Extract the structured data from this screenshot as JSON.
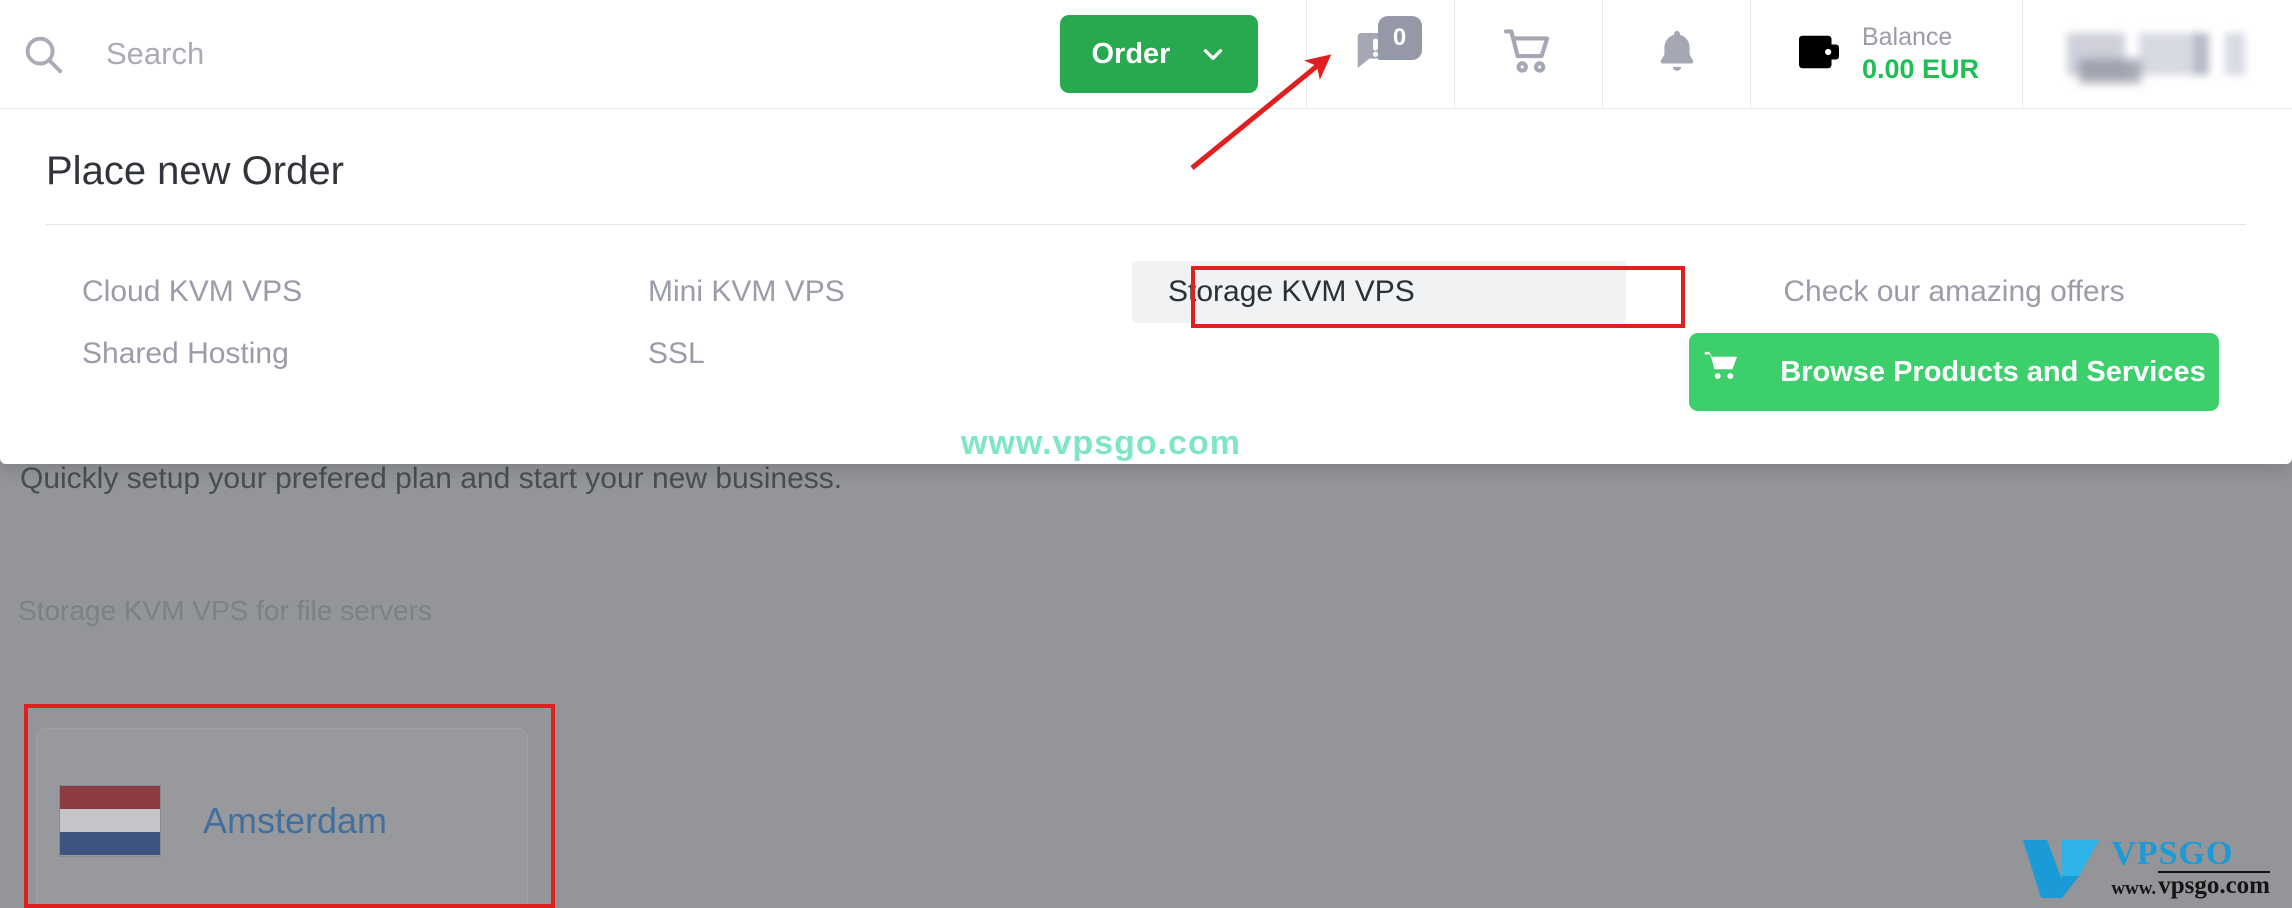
{
  "header": {
    "search": {
      "value": "",
      "placeholder": "Search"
    },
    "order_button": {
      "label": "Order",
      "chevron_icon": "chevron-down-icon"
    },
    "support_tickets": {
      "icon": "support-ticket-icon",
      "badge_count": "0"
    },
    "cart": {
      "icon": "shopping-cart-icon"
    },
    "notifications": {
      "icon": "bell-icon"
    },
    "balance": {
      "icon": "wallet-icon",
      "label": "Balance",
      "amount": "0.00 EUR"
    },
    "user": {
      "name_redacted": ""
    }
  },
  "panel": {
    "title": "Place new Order",
    "column_1": [
      {
        "label": "Cloud KVM VPS",
        "active": false
      },
      {
        "label": "Shared Hosting",
        "active": false
      }
    ],
    "column_2": [
      {
        "label": "Mini KVM VPS",
        "active": false
      },
      {
        "label": "SSL",
        "active": false
      }
    ],
    "column_3": [
      {
        "label": "Storage KVM VPS",
        "active": true
      }
    ],
    "cta": {
      "text": "Check our amazing offers",
      "button_label": "Browse Products and Services",
      "button_icon": "shopping-cart-icon"
    }
  },
  "background": {
    "tagline": "Quickly setup your prefered plan and start your new business.",
    "section_title": "Storage KVM VPS for file servers",
    "locations": [
      {
        "name": "Amsterdam",
        "flag": "netherlands-flag-icon"
      }
    ]
  },
  "annotations": {
    "arrow_target": "order-button",
    "boxes": [
      {
        "target": "Storage KVM VPS"
      },
      {
        "target": "Amsterdam"
      }
    ],
    "color": "#e02020"
  },
  "watermark": {
    "text": "www.vpsgo.com",
    "logo_brand": "VPSGO",
    "logo_www": "www.",
    "logo_domain": "vpsgo.com"
  },
  "colors": {
    "order_green": "#28a950",
    "cta_green": "#3ecf6d",
    "balance_green": "#1fbe55",
    "link_gray": "#9a9da8",
    "annotation_red": "#e02020",
    "watermark_teal": "#7fe6c4",
    "overlay_gray": "#939598"
  }
}
